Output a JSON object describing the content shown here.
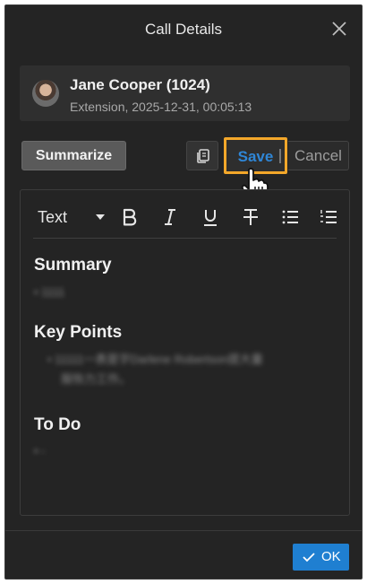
{
  "dialog": {
    "title": "Call Details"
  },
  "contact": {
    "name": "Jane Cooper (1024)",
    "meta": "Extension, 2025-12-31, 00:05:13"
  },
  "actions": {
    "summarize_label": "Summarize",
    "save_label": "Save",
    "cancel_label": "Cancel"
  },
  "toolbar": {
    "format_label": "Text",
    "icons": [
      "bold-icon",
      "italic-icon",
      "underline-icon",
      "strikethrough-icon",
      "bullet-list-icon",
      "numbered-list-icon"
    ]
  },
  "notes": {
    "summary_title": "Summary",
    "summary_text": "• 1111",
    "key_points_title": "Key Points",
    "key_points_line1": "• 11111一表是字Darlene Robertson提大量",
    "key_points_line2": "服恢力工作。",
    "todo_title": "To Do",
    "todo_text": "• -"
  },
  "footer": {
    "ok_label": "OK"
  },
  "colors": {
    "background": "#242424",
    "accent": "#1f7fd1",
    "highlight": "#f3a72a",
    "save_text": "#2f86d6"
  }
}
